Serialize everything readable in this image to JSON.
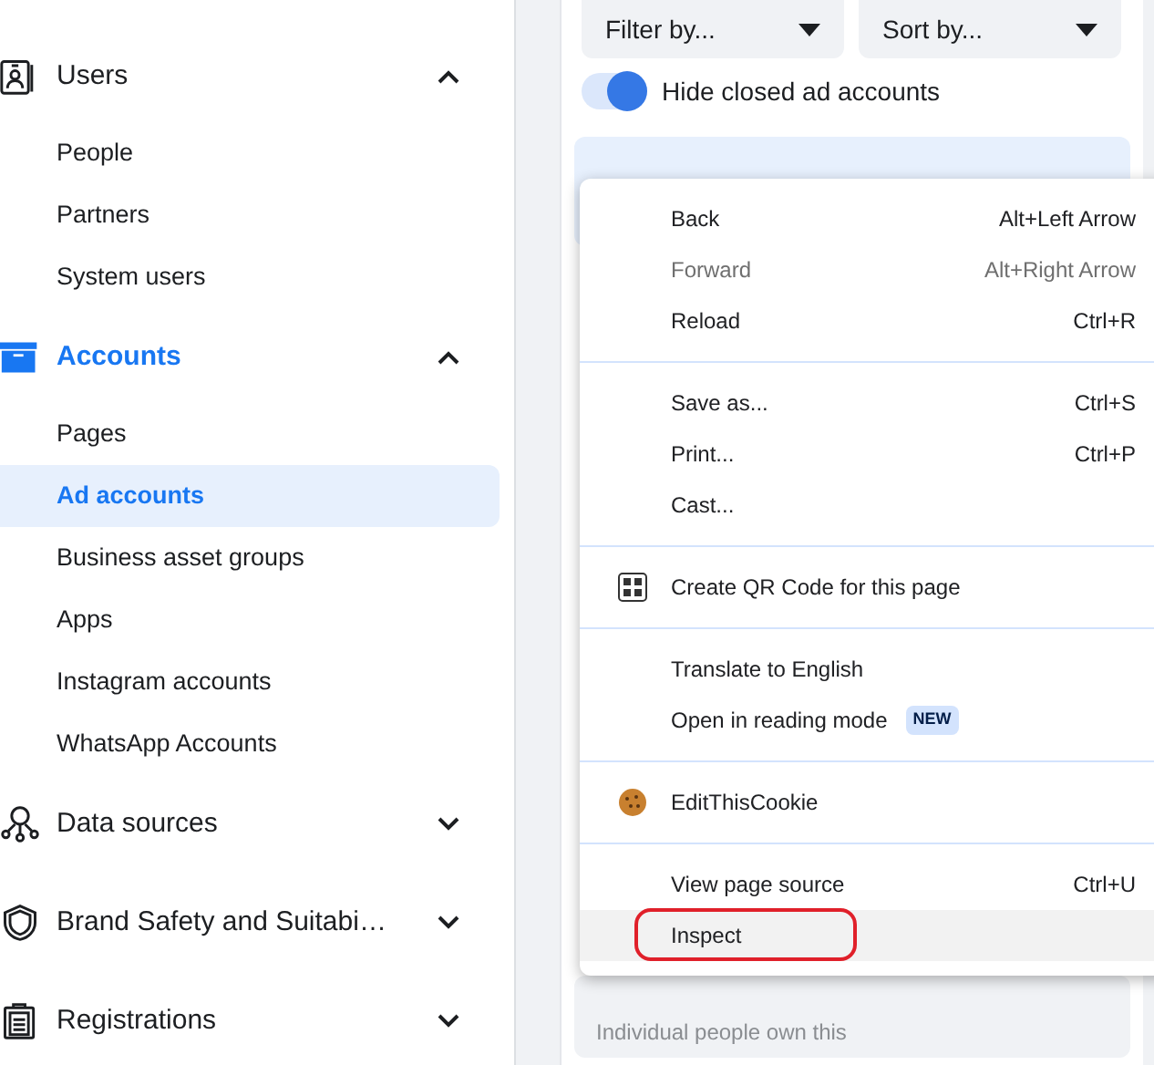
{
  "sidebar": {
    "sections": [
      {
        "label": "Users",
        "expanded": true,
        "active": false,
        "children": [
          {
            "label": "People",
            "selected": false
          },
          {
            "label": "Partners",
            "selected": false
          },
          {
            "label": "System users",
            "selected": false
          }
        ]
      },
      {
        "label": "Accounts",
        "expanded": true,
        "active": true,
        "children": [
          {
            "label": "Pages",
            "selected": false
          },
          {
            "label": "Ad accounts",
            "selected": true
          },
          {
            "label": "Business asset groups",
            "selected": false
          },
          {
            "label": "Apps",
            "selected": false
          },
          {
            "label": "Instagram accounts",
            "selected": false
          },
          {
            "label": "WhatsApp Accounts",
            "selected": false
          }
        ]
      },
      {
        "label": "Data sources",
        "expanded": false,
        "active": false
      },
      {
        "label": "Brand Safety and Suitabi…",
        "expanded": false,
        "active": false
      },
      {
        "label": "Registrations",
        "expanded": false,
        "active": false
      }
    ]
  },
  "filters": [
    {
      "label": "Filter by..."
    },
    {
      "label": "Sort by..."
    }
  ],
  "toggle": {
    "label": "Hide closed ad accounts",
    "on": true
  },
  "cards": [
    {
      "selected": true
    },
    {
      "subtitle": "Individual people own this",
      "selected": false
    }
  ],
  "context_menu": {
    "groups": [
      [
        {
          "label": "Back",
          "shortcut": "Alt+Left Arrow",
          "disabled": false,
          "highlighted": false,
          "circled": false
        },
        {
          "label": "Forward",
          "shortcut": "Alt+Right Arrow",
          "disabled": true,
          "highlighted": false,
          "circled": false
        },
        {
          "label": "Reload",
          "shortcut": "Ctrl+R",
          "disabled": false,
          "highlighted": false,
          "circled": false
        }
      ],
      [
        {
          "label": "Save as...",
          "shortcut": "Ctrl+S",
          "disabled": false,
          "highlighted": false,
          "circled": false
        },
        {
          "label": "Print...",
          "shortcut": "Ctrl+P",
          "disabled": false,
          "highlighted": false,
          "circled": false
        },
        {
          "label": "Cast...",
          "disabled": false,
          "highlighted": false,
          "circled": false
        }
      ],
      [
        {
          "label": "Create QR Code for this page",
          "kind": "qr",
          "disabled": false,
          "highlighted": false,
          "circled": false
        }
      ],
      [
        {
          "label": "Translate to English",
          "disabled": false,
          "highlighted": false,
          "circled": false
        },
        {
          "label": "Open in reading mode",
          "badge": "NEW",
          "disabled": false,
          "highlighted": false,
          "circled": false
        }
      ],
      [
        {
          "label": "EditThisCookie",
          "kind": "cookie",
          "disabled": false,
          "highlighted": false,
          "circled": false
        }
      ],
      [
        {
          "label": "View page source",
          "shortcut": "Ctrl+U",
          "disabled": false,
          "highlighted": false,
          "circled": false
        },
        {
          "label": "Inspect",
          "disabled": false,
          "highlighted": true,
          "circled": true
        }
      ]
    ]
  }
}
